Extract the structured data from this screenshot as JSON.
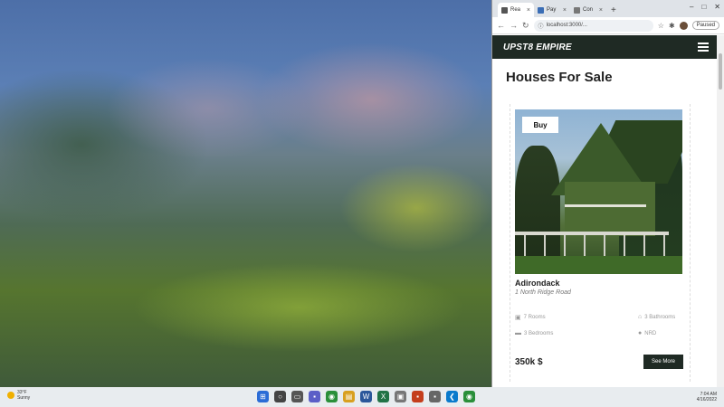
{
  "desktop": {
    "weather": {
      "temp": "33°F",
      "condition": "Sunny"
    }
  },
  "browser": {
    "tabs": [
      {
        "label": "Rea",
        "active": true
      },
      {
        "label": "Pay",
        "active": false
      },
      {
        "label": "Con",
        "active": false
      }
    ],
    "new_tab": "+",
    "url": "localhost:3000/...",
    "paused_label": "Paused"
  },
  "site": {
    "brand": "UPST8 EMPIRE",
    "heading": "Houses For Sale",
    "listing": {
      "badge": "Buy",
      "title": "Adirondack",
      "address": "1 North Ridge Road",
      "features": {
        "rooms": "7 Rooms",
        "bathrooms": "3 Bathrooms",
        "bedrooms": "3 Bedrooms",
        "location": "NRD"
      },
      "price": "350k $",
      "cta": "See More"
    }
  },
  "taskbar": {
    "time": "7:04 AM",
    "date": "4/16/2022"
  },
  "colors": {
    "nav_bg": "#1f2a24",
    "accent": "#1f2a24"
  }
}
